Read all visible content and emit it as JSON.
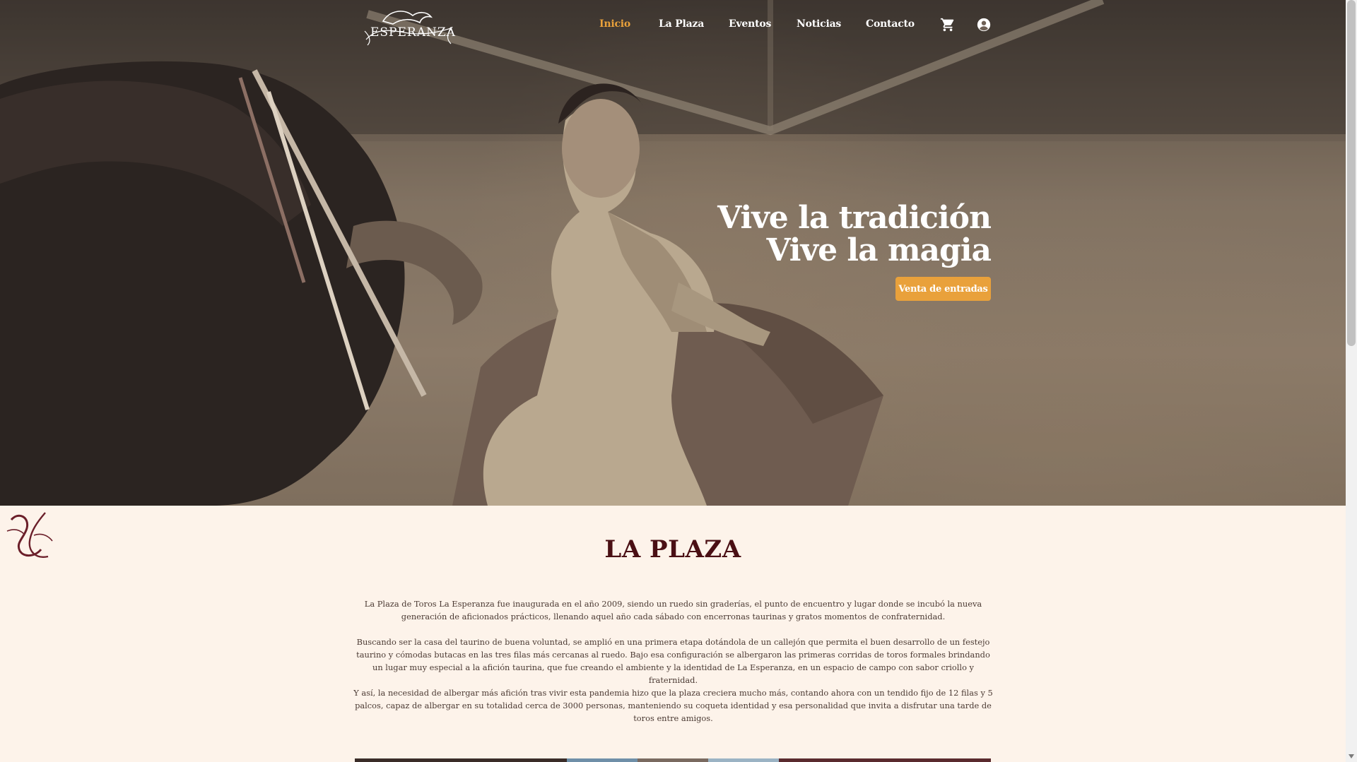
{
  "nav": {
    "logo_text": "ESPERANZA",
    "items": [
      {
        "label": "Inicio",
        "active": true
      },
      {
        "label": "La Plaza",
        "active": false
      },
      {
        "label": "Eventos",
        "active": false
      },
      {
        "label": "Noticias",
        "active": false
      },
      {
        "label": "Contacto",
        "active": false
      }
    ],
    "cart_icon": "cart-icon",
    "account_icon": "account-icon"
  },
  "hero": {
    "title_line1": "Vive la tradición",
    "title_line2": "Vive la magia",
    "cta_label": "Venta de entradas"
  },
  "plaza": {
    "title": "LA PLAZA",
    "paragraph1": "La Plaza de Toros La Esperanza fue inaugurada en el año 2009, siendo un ruedo sin graderías, el punto de encuentro y lugar donde se incubó la nueva generación de aficionados prácticos, llenando aquel año cada sábado con encerronas taurinas y gratos momentos de confraternidad.",
    "paragraph2": "Buscando ser la casa del taurino de buena voluntad, se amplió en una primera etapa dotándola de un callejón que permita el buen desarrollo de un festejo taurino y cómodas butacas en las tres filas más cercanas al ruedo. Bajo esa configuración se albergaron las primeras corridas de toros formales brindando un lugar muy especial a la afición taurina, que fue creando el ambiente y la identidad de La Esperanza, en un espacio de campo con sabor criollo y fraternidad.",
    "paragraph3": "Y así, la necesidad de albergar más afición tras vivir esta pandemia hizo que la plaza creciera mucho más, contando ahora con un tendido fijo de 12 filas y 5 palcos, capaz de albergar en su totalidad cerca de 3000 personas, manteniendo su coqueta identidad y esa personalidad que invita a disfrutar una tarde de toros entre amigos."
  },
  "colors": {
    "accent": "#e9a13b",
    "title": "#4a0f14",
    "background": "#fdf3ea",
    "text": "#4b3a33"
  }
}
